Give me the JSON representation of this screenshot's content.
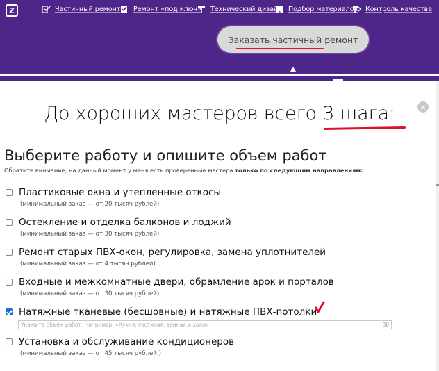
{
  "nav": {
    "logo": "Z",
    "items": [
      {
        "label": "Частичный ремонт",
        "icon": "checkmark-icon"
      },
      {
        "label": "Ремонт «под ключ»",
        "icon": "checkbox-icon"
      },
      {
        "label": "Технический дизайн",
        "icon": "paint-roller-icon"
      },
      {
        "label": "Подбор материалов",
        "icon": "bookmark-icon"
      },
      {
        "label": "Контроль качества",
        "icon": "roller-tools-icon"
      }
    ]
  },
  "banner": {
    "order_button": "Заказать частичный ремонт"
  },
  "modal": {
    "headline": "До хороших мастеров всего 3 шага:",
    "close": "×",
    "section_title": "Выберите работу и опишите объем работ",
    "notice_prefix": "Обратите внимание, на данный момент у меня есть проверенные мастера ",
    "notice_bold": "только по следующим направлениям:",
    "options": [
      {
        "label": "Пластиковые окна и утепленные откосы",
        "sub": "(минимальный заказ — от 20 тысяч рублей)",
        "checked": false
      },
      {
        "label": "Остекление и отделка балконов и лоджий",
        "sub": "(минимальный заказ — от 30 тысяч рублей)",
        "checked": false
      },
      {
        "label": "Ремонт старых ПВХ-окон, регулировка, замена уплотнителей",
        "sub": "(минимальный заказ — от 4 тысяч рублей)",
        "checked": false
      },
      {
        "label": "Входные и межкомнатные двери, обрамление арок и порталов",
        "sub": "(минимальный заказ — от 30 тысяч рублей)",
        "checked": false
      },
      {
        "label": "Натяжные тканевые (бесшовные) и натяжные ПВХ-потолки",
        "sub": "",
        "checked": true
      },
      {
        "label": "Установка и обслуживание кондиционеров",
        "sub": "(минимальный заказ — от 45 тысяч рублей.)",
        "checked": false
      }
    ],
    "volume_placeholder": "Укажите объём работ. Например, «Кухня, гостиная, ванная и холл»",
    "volume_counter": "80"
  },
  "colors": {
    "brand_purple": "#4e2589",
    "accent_red": "#e0102c",
    "checkbox_blue": "#1e6fd9"
  }
}
